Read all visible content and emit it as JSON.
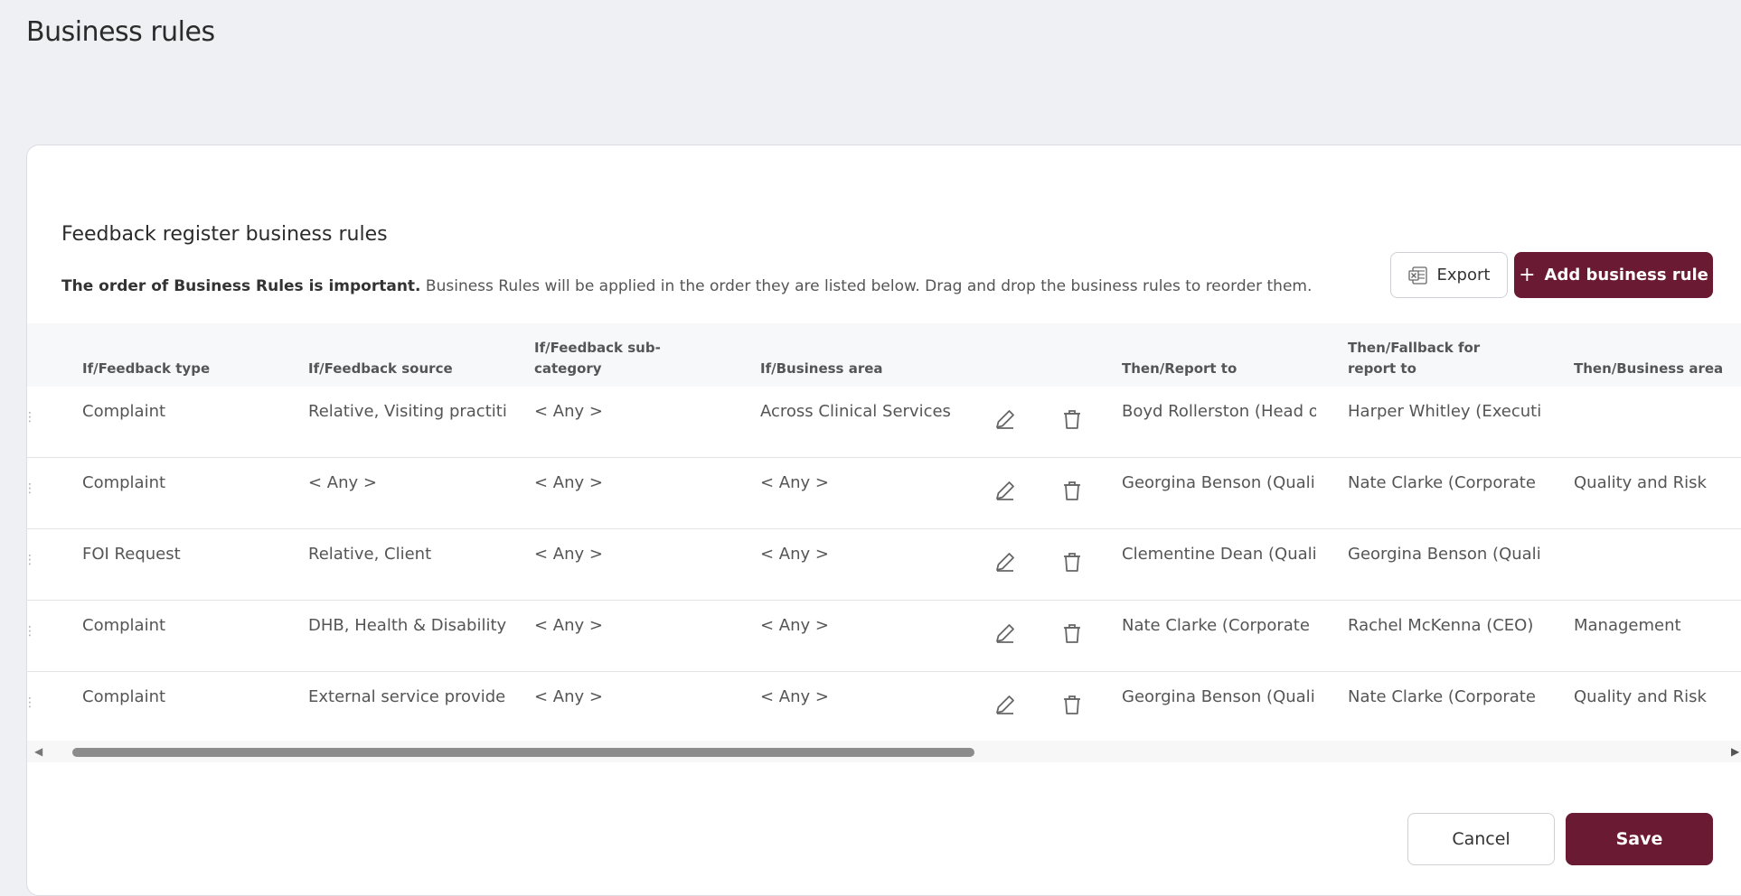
{
  "page": {
    "title": "Business rules"
  },
  "section": {
    "title": "Feedback register business rules",
    "intro_bold": "The order of Business Rules is important.",
    "intro_rest": "Business Rules will be applied in the order they are listed below. Drag and drop the business rules to reorder them."
  },
  "toolbar": {
    "export_label": "Export",
    "add_label": "Add business rule"
  },
  "table": {
    "headers": {
      "feedback_type": "If/Feedback type",
      "feedback_source": "If/Feedback source",
      "sub_category_l1": "If/Feedback sub-",
      "sub_category_l2": "category",
      "business_area": "If/Business area",
      "report_to": "Then/Report to",
      "fallback_l1": "Then/Fallback for",
      "fallback_l2": "report to",
      "then_business_area": "Then/Business area"
    },
    "rows": [
      {
        "type": "Complaint",
        "source": "Relative, Visiting practiti...",
        "sub_category": "< Any >",
        "business_area": "Across Clinical Services",
        "report_to": "Boyd Rollerston (Head o...",
        "fallback": "Harper Whitley (Executiv...",
        "then_area": ""
      },
      {
        "type": "Complaint",
        "source": "< Any >",
        "sub_category": "< Any >",
        "business_area": "< Any >",
        "report_to": "Georgina Benson (Quali...",
        "fallback": "Nate Clarke (Corporate ...",
        "then_area": "Quality and Risk"
      },
      {
        "type": "FOI Request",
        "source": "Relative, Client",
        "sub_category": "< Any >",
        "business_area": "< Any >",
        "report_to": "Clementine Dean (Quali...",
        "fallback": "Georgina Benson (Quali...",
        "then_area": ""
      },
      {
        "type": "Complaint",
        "source": "DHB, Health & Disability,...",
        "sub_category": "< Any >",
        "business_area": "< Any >",
        "report_to": "Nate Clarke (Corporate ...",
        "fallback": "Rachel McKenna (CEO)",
        "then_area": "Management"
      },
      {
        "type": "Complaint",
        "source": "External service provide...",
        "sub_category": "< Any >",
        "business_area": "< Any >",
        "report_to": "Georgina Benson (Quali...",
        "fallback": "Nate Clarke (Corporate ...",
        "then_area": "Quality and Risk"
      }
    ]
  },
  "footer": {
    "cancel_label": "Cancel",
    "save_label": "Save"
  },
  "colors": {
    "primary": "#6b1a33",
    "background": "#eff0f3",
    "excel": "#1f6e43"
  },
  "icons": {
    "export": "excel-icon",
    "add": "plus-icon",
    "edit": "pencil-icon",
    "delete": "trash-icon",
    "drag": "drag-handle-icon"
  }
}
